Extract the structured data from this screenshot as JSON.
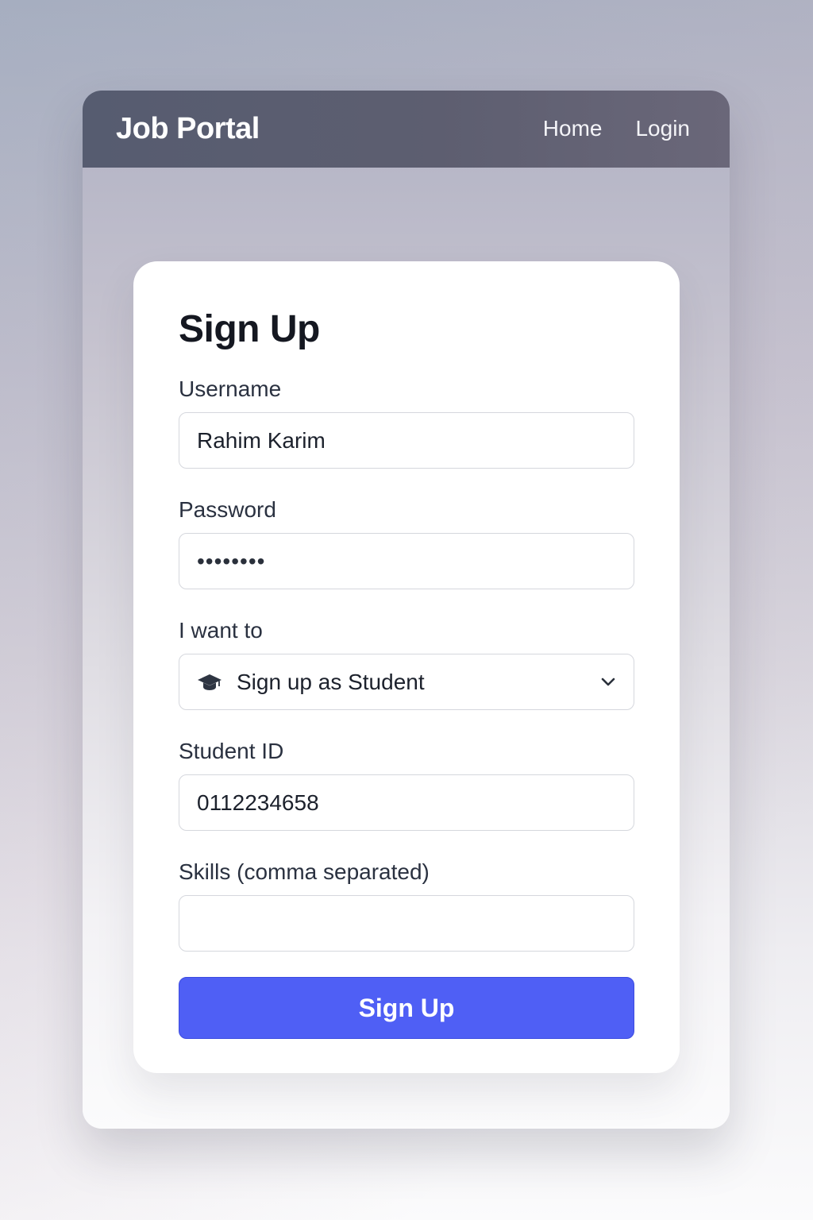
{
  "navbar": {
    "brand": "Job Portal",
    "links": [
      {
        "label": "Home"
      },
      {
        "label": "Login"
      }
    ]
  },
  "form": {
    "title": "Sign Up",
    "username": {
      "label": "Username",
      "value": "Rahim Karim"
    },
    "password": {
      "label": "Password",
      "value": "••••••••"
    },
    "role": {
      "label": "I want to",
      "selected": "Sign up as Student",
      "icon": "graduation-cap-icon"
    },
    "student_id": {
      "label": "Student ID",
      "value": "0112234658"
    },
    "skills": {
      "label": "Skills (comma separated)",
      "value": ""
    },
    "submit_label": "Sign Up"
  },
  "colors": {
    "navbar": "#5a5e71",
    "accent": "#4f5ff5",
    "card": "#ffffff"
  }
}
